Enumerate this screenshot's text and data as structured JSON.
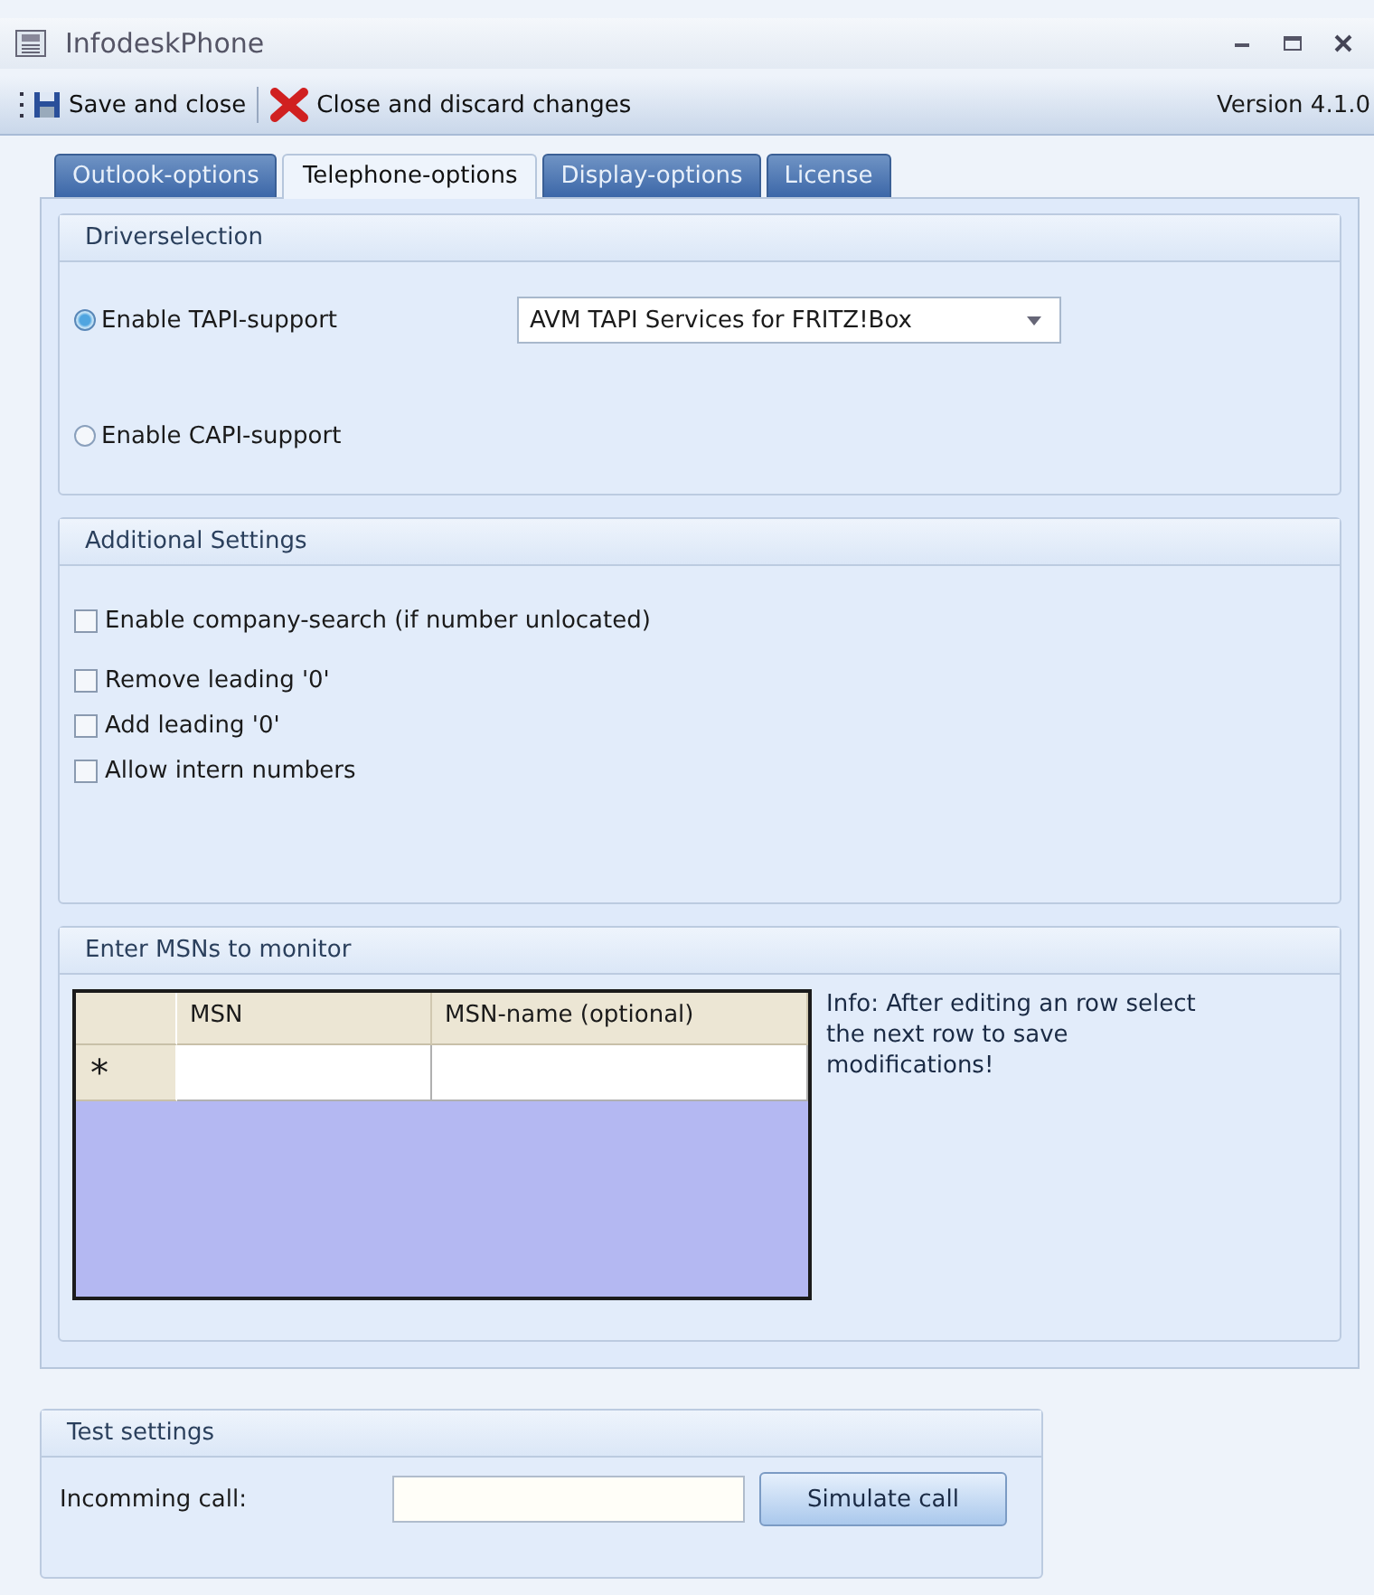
{
  "window": {
    "title": "InfodeskPhone"
  },
  "toolbar": {
    "buttons": [
      {
        "label": "Save and close",
        "kind": "save"
      },
      {
        "label": "Close and discard changes",
        "kind": "discard"
      }
    ],
    "version": "Version 4.1.0"
  },
  "tabs": [
    {
      "label": "Outlook-options",
      "selected": false
    },
    {
      "label": "Telephone-options",
      "selected": true
    },
    {
      "label": "Display-options",
      "selected": false
    },
    {
      "label": "License",
      "selected": false
    }
  ],
  "driver_selection": {
    "title": "Driverselection",
    "options": [
      {
        "label": "Enable TAPI-support",
        "selected": true
      },
      {
        "label": "Enable CAPI-support",
        "selected": false
      }
    ],
    "driver_dropdown": {
      "value": "AVM TAPI Services for FRITZ!Box"
    }
  },
  "additional_settings": {
    "title": "Additional Settings",
    "checkboxes": [
      {
        "label": "Enable company-search (if number unlocated)",
        "checked": false
      },
      {
        "label": "Remove leading '0'",
        "checked": false
      },
      {
        "label": "Add leading '0'",
        "checked": false
      },
      {
        "label": "Allow intern numbers",
        "checked": false
      }
    ]
  },
  "msn_monitor": {
    "title": "Enter MSNs to monitor",
    "table": {
      "columns": [
        "MSN",
        "MSN-name (optional)"
      ],
      "new_row_marker": "*"
    },
    "info": "Info: After editing an row select the next row to save modifications!"
  },
  "test_settings": {
    "title": "Test settings",
    "label": "Incomming call:",
    "button": "Simulate call"
  }
}
